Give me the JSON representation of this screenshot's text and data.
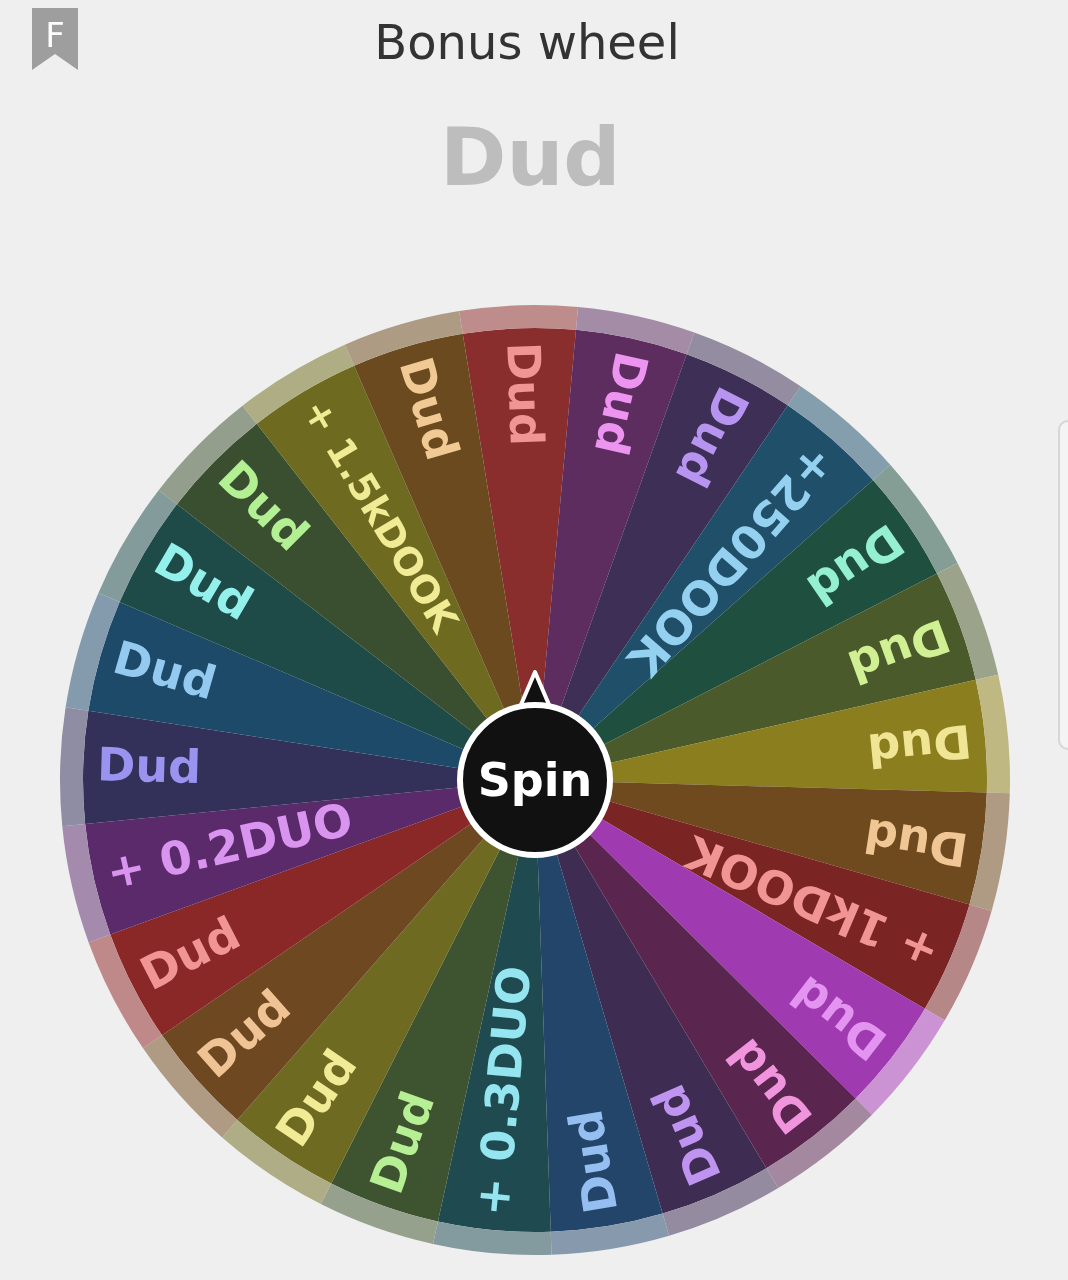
{
  "header": {
    "badge": "F",
    "title": "Bonus wheel"
  },
  "result": "Dud",
  "wheel": {
    "button": "Spin",
    "segments": [
      {
        "label": "Dud",
        "color": "#8a2d2d"
      },
      {
        "label": "Dud",
        "color": "#5c2d5e"
      },
      {
        "label": "Dud",
        "color": "#3d2f55"
      },
      {
        "label": "+250DOOK",
        "color": "#1f4f69"
      },
      {
        "label": "Dud",
        "color": "#1f4f3f"
      },
      {
        "label": "Dud",
        "color": "#4a5a2a"
      },
      {
        "label": "Dud",
        "color": "#8a7e1e"
      },
      {
        "label": "Dud",
        "color": "#6e4a1e"
      },
      {
        "label": "+ 1kDOOK",
        "color": "#7a2424"
      },
      {
        "label": "Dud",
        "color": "#a03ab0"
      },
      {
        "label": "Dud",
        "color": "#5a2650"
      },
      {
        "label": "Dud",
        "color": "#3e2c52"
      },
      {
        "label": "Dud",
        "color": "#24456a"
      },
      {
        "label": "+ 0.3DUO",
        "color": "#1e4a50"
      },
      {
        "label": "Dud",
        "color": "#3e5430"
      },
      {
        "label": "Dud",
        "color": "#6e6a22"
      },
      {
        "label": "Dud",
        "color": "#6e4820"
      },
      {
        "label": "Dud",
        "color": "#8a2828"
      },
      {
        "label": "+ 0.2DUO",
        "color": "#5a2a6a"
      },
      {
        "label": "Dud",
        "color": "#33305a"
      },
      {
        "label": "Dud",
        "color": "#1e4a6a"
      },
      {
        "label": "Dud",
        "color": "#1e4a48"
      },
      {
        "label": "Dud",
        "color": "#3a4e30"
      },
      {
        "label": "+ 1.5kDOOK",
        "color": "#6e6a20"
      },
      {
        "label": "Dud",
        "color": "#6a4a1e"
      }
    ]
  }
}
